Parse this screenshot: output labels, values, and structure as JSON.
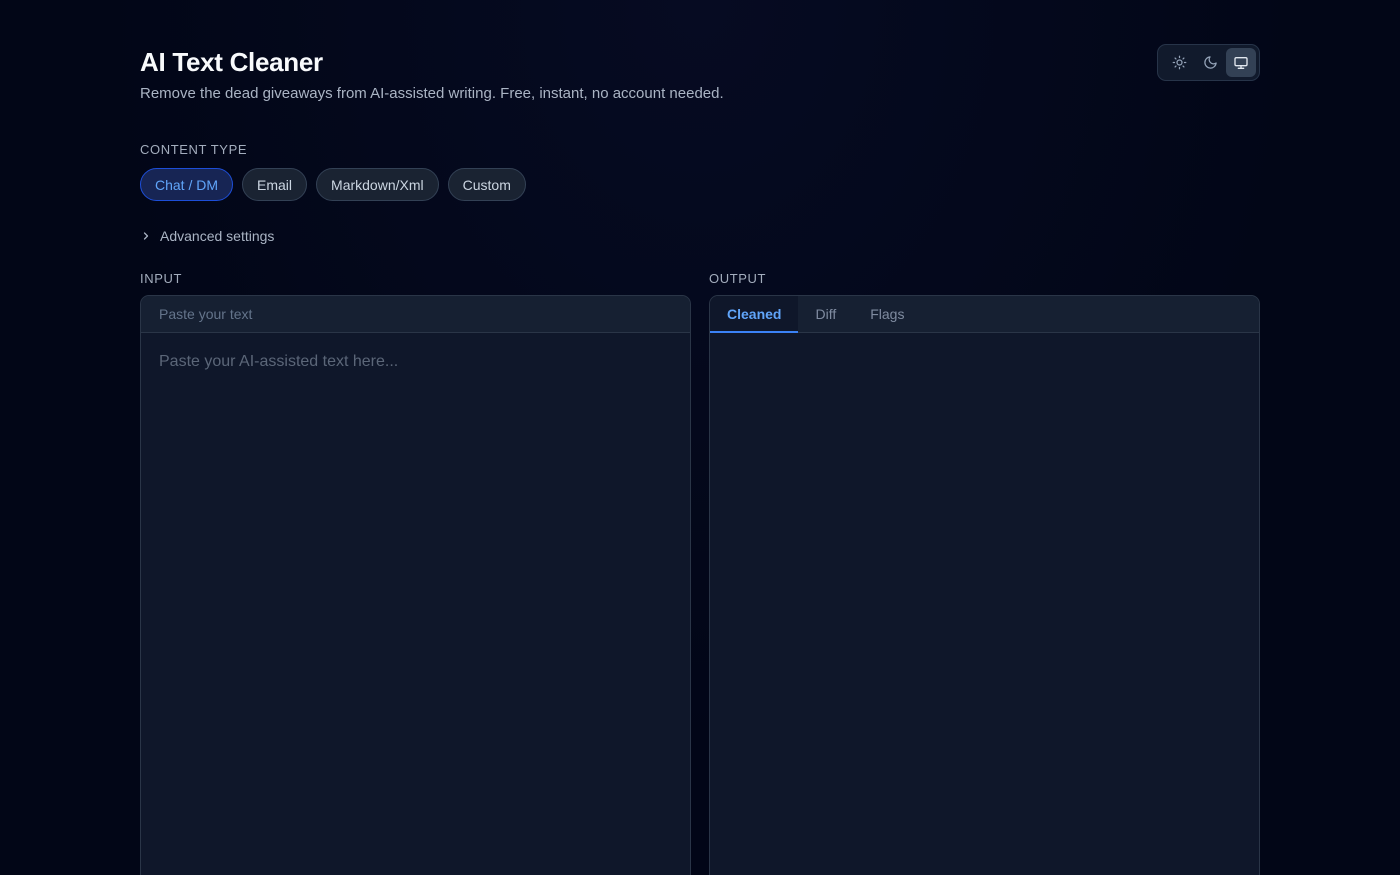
{
  "header": {
    "title": "AI Text Cleaner",
    "subtitle": "Remove the dead giveaways from AI-assisted writing. Free, instant, no account needed."
  },
  "theme_toggle": {
    "options": [
      {
        "icon": "sun-icon",
        "active": false
      },
      {
        "icon": "moon-icon",
        "active": false
      },
      {
        "icon": "monitor-icon",
        "active": true
      }
    ]
  },
  "content_type": {
    "label": "CONTENT TYPE",
    "options": [
      "Chat / DM",
      "Email",
      "Markdown/Xml",
      "Custom"
    ],
    "selected": "Chat / DM"
  },
  "advanced": {
    "label": "Advanced settings",
    "icon": "chevron-right-icon"
  },
  "input": {
    "label": "INPUT",
    "header": "Paste your text",
    "placeholder": "Paste your AI-assisted text here...",
    "value": ""
  },
  "output": {
    "label": "OUTPUT",
    "tabs": [
      "Cleaned",
      "Diff",
      "Flags"
    ],
    "active_tab": "Cleaned",
    "value": ""
  },
  "colors": {
    "background": "#020617",
    "panel": "#0f172a",
    "accent": "#3b82f6",
    "accent_text": "#60a5fa"
  }
}
